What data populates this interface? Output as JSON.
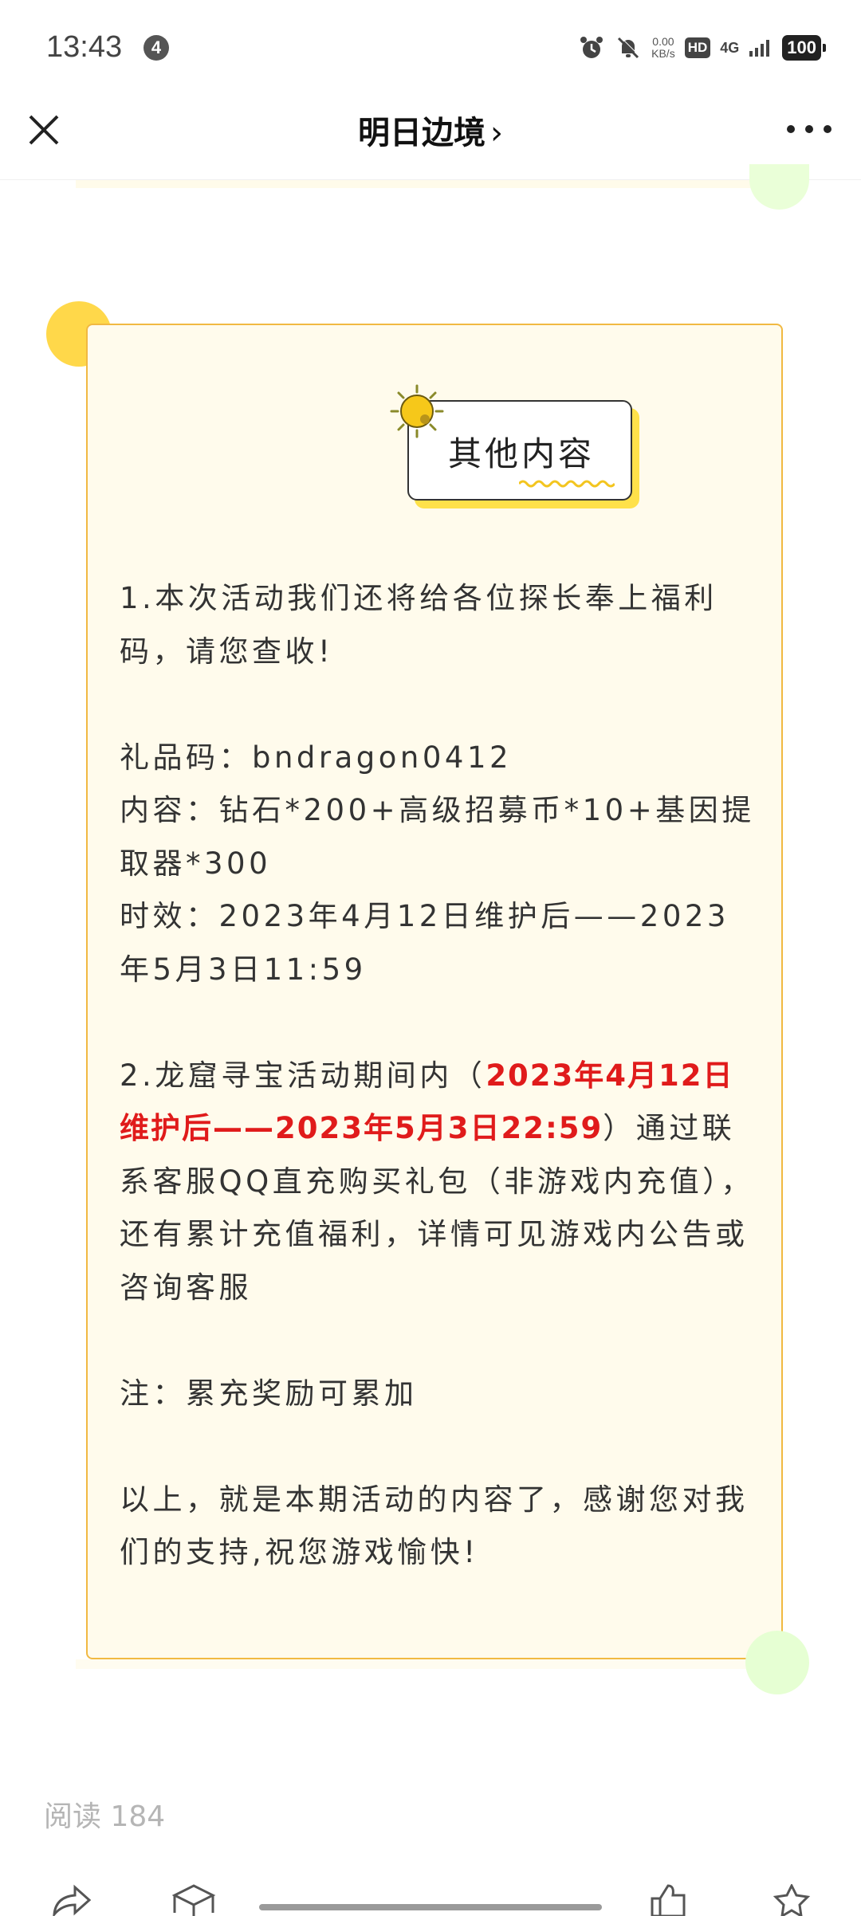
{
  "status_bar": {
    "time": "13:43",
    "notification_count": "4",
    "net_speed_value": "0.00",
    "net_speed_unit": "KB/s",
    "hd_label": "HD",
    "network_type": "4G",
    "battery": "100"
  },
  "nav": {
    "title": "明日边境",
    "chevron": "›",
    "close_icon": "close-icon",
    "more_icon": "more-dots-icon"
  },
  "card": {
    "heading": "其他内容",
    "para1": "1.本次活动我们还将给各位探长奉上福利码，请您查收!",
    "gift_code_line": "礼品码：bndragon0412",
    "content_line": "内容：钻石*200+高级招募币*10+基因提取器*300",
    "validity_line": "时效：2023年4月12日维护后——2023年5月3日11:59",
    "para2_prefix": "2.龙窟寻宝活动期间内（",
    "para2_highlight": "2023年4月12日维护后——2023年5月3日22:59",
    "para2_suffix": "）通过联系客服QQ直充购买礼包（非游戏内充值），还有累计充值福利，详情可见游戏内公告或咨询客服",
    "note": "注：累充奖励可累加",
    "closing": "以上，就是本期活动的内容了，感谢您对我们的支持,祝您游戏愉快!"
  },
  "footer": {
    "read_count": "阅读 184"
  },
  "colors": {
    "card_bg": "#fffbec",
    "card_border": "#f1b942",
    "highlight_red": "#e01b1b",
    "accent_yellow": "#ffd84a",
    "accent_green": "#e6ffd3"
  }
}
